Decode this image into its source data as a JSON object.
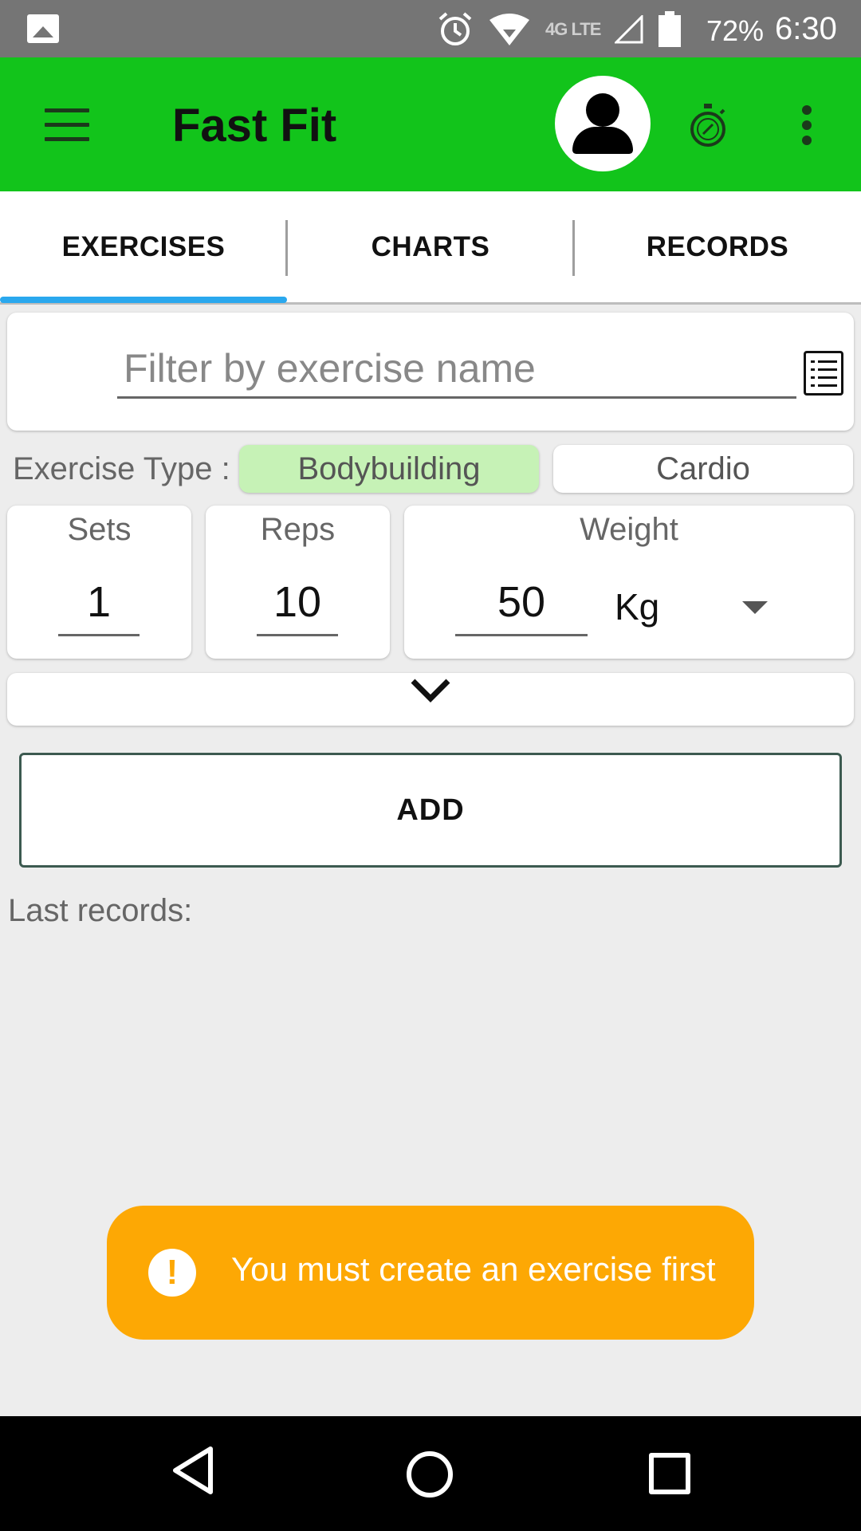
{
  "status_bar": {
    "network": "4G LTE",
    "battery": "72%",
    "time": "6:30"
  },
  "app_bar": {
    "title": "Fast Fit"
  },
  "tabs": [
    {
      "label": "EXERCISES",
      "selected": true
    },
    {
      "label": "CHARTS",
      "selected": false
    },
    {
      "label": "RECORDS",
      "selected": false
    }
  ],
  "filter": {
    "placeholder": "Filter by exercise name",
    "value": ""
  },
  "exercise_type": {
    "label": "Exercise Type :",
    "options": [
      {
        "label": "Bodybuilding",
        "selected": true
      },
      {
        "label": "Cardio",
        "selected": false
      }
    ]
  },
  "inputs": {
    "sets": {
      "label": "Sets",
      "value": "1"
    },
    "reps": {
      "label": "Reps",
      "value": "10"
    },
    "weight": {
      "label": "Weight",
      "value": "50",
      "unit": "Kg"
    }
  },
  "add_button": "ADD",
  "last_records_label": "Last records:",
  "toast": {
    "icon": "!",
    "message": "You must create an exercise first"
  },
  "colors": {
    "app_bar": "#12c41b",
    "tab_indicator": "#2aa8ee",
    "bodybuilding_selected": "#c6f2b6",
    "toast": "#fda804"
  }
}
